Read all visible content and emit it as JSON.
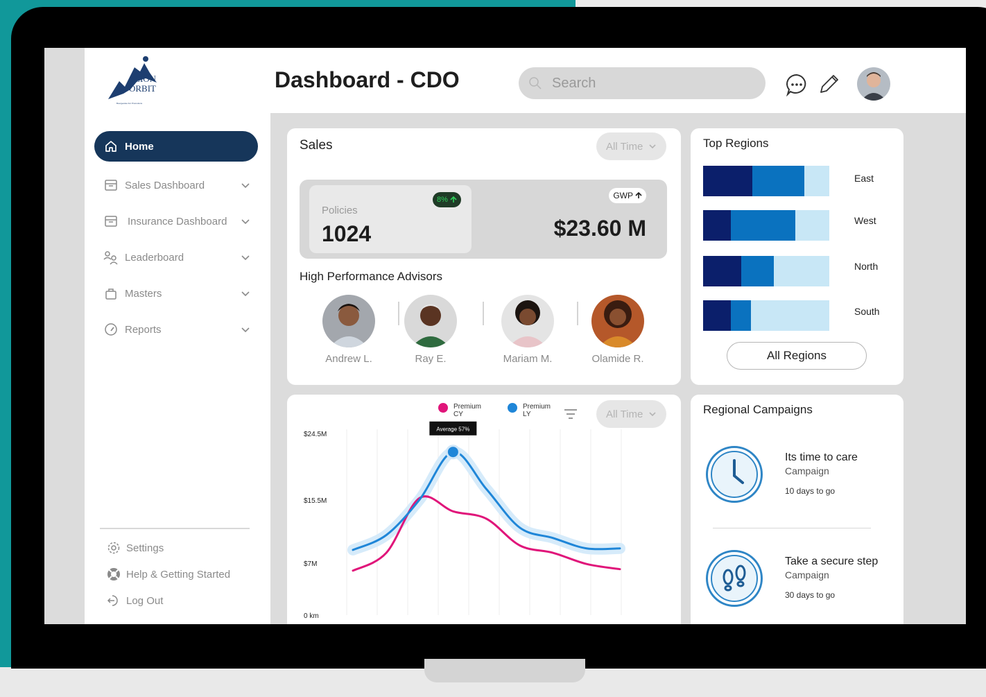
{
  "header": {
    "title": "Dashboard - CDO",
    "search_placeholder": "Search"
  },
  "logo": {
    "line1": "LION",
    "line2": "ORBIT",
    "tagline": "Bourgeoisie For Promotions"
  },
  "sidebar": {
    "items": [
      {
        "label": "Home",
        "icon": "home-icon",
        "active": true
      },
      {
        "label": "Sales Dashboard",
        "icon": "archive-icon"
      },
      {
        "label": "Insurance Dashboard",
        "icon": "archive-icon"
      },
      {
        "label": "Leaderboard",
        "icon": "users-icon"
      },
      {
        "label": "Masters",
        "icon": "bag-icon"
      },
      {
        "label": "Reports",
        "icon": "gauge-icon"
      }
    ],
    "footer": [
      {
        "label": "Settings",
        "icon": "gear-icon"
      },
      {
        "label": "Help & Getting Started",
        "icon": "lifebuoy-icon"
      },
      {
        "label": "Log Out",
        "icon": "logout-icon"
      }
    ]
  },
  "sales": {
    "title": "Sales",
    "filter": "All Time",
    "policies_label": "Policies",
    "policies_value": "1024",
    "policies_change": "8%",
    "gwp_label": "GWP",
    "gwp_value": "$23.60 M",
    "advisors_title": "High Performance Advisors",
    "advisors": [
      {
        "name": "Andrew L."
      },
      {
        "name": "Ray E."
      },
      {
        "name": "Mariam M."
      },
      {
        "name": "Olamide R."
      }
    ]
  },
  "top_regions": {
    "title": "Top Regions",
    "button": "All Regions",
    "regions": [
      {
        "name": "East",
        "segments": [
          0.39,
          0.41,
          0.2
        ]
      },
      {
        "name": "West",
        "segments": [
          0.22,
          0.51,
          0.27
        ]
      },
      {
        "name": "North",
        "segments": [
          0.3,
          0.26,
          0.44
        ]
      },
      {
        "name": "South",
        "segments": [
          0.22,
          0.16,
          0.62
        ]
      }
    ],
    "colors": [
      "#0b1f6b",
      "#0a72bf",
      "#c8e7f6"
    ]
  },
  "premium_chart": {
    "filter": "All Time",
    "legend": [
      {
        "label": "Premium\nCY",
        "color": "#e0157a"
      },
      {
        "label": "Premium\nLY",
        "color": "#1f86d8"
      }
    ],
    "tooltip": "Average 57%",
    "y_ticks": [
      "$24.5M",
      "$15.5M",
      "$7M",
      "0 km"
    ]
  },
  "chart_data": {
    "type": "line",
    "y_ticks": [
      "$24.5M",
      "$15.5M",
      "$7M",
      "0 km"
    ],
    "x": [
      0,
      1,
      2,
      3,
      4,
      5,
      6,
      7,
      8
    ],
    "series": [
      {
        "name": "Premium CY",
        "values": [
          6.0,
          8.4,
          15.8,
          14.0,
          13.0,
          9.4,
          8.4,
          6.9,
          6.2
        ]
      },
      {
        "name": "Premium LY",
        "values": [
          8.8,
          10.8,
          15.6,
          22.0,
          17.0,
          11.8,
          10.4,
          9.0,
          9.0
        ]
      }
    ],
    "ylim": [
      0,
      24.5
    ],
    "grid": "vertical",
    "legend": "top-center"
  },
  "campaigns": {
    "title": "Regional Campaigns",
    "items": [
      {
        "name": "Its time to care",
        "type": "Campaign",
        "days": "10 days to go",
        "icon": "clock-icon"
      },
      {
        "name": "Take a secure step",
        "type": "Campaign",
        "days": "30 days to go",
        "icon": "footprints-icon"
      }
    ]
  }
}
